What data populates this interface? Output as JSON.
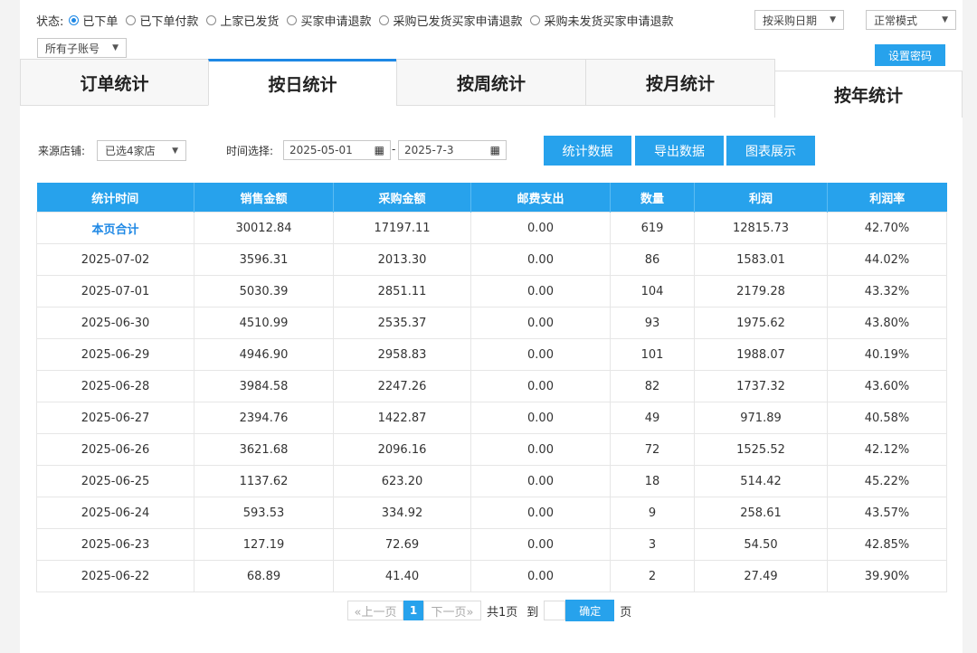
{
  "status": {
    "label": "状态:",
    "options": [
      "已下单",
      "已下单付款",
      "上家已发货",
      "买家申请退款",
      "采购已发货买家申请退款",
      "采购未发货买家申请退款"
    ],
    "selected_index": 0
  },
  "controls": {
    "date_type": "按采购日期",
    "mode": "正常模式",
    "sub_account": "所有子账号",
    "set_password": "设置密码"
  },
  "tabs": [
    "订单统计",
    "按日统计",
    "按周统计",
    "按月统计",
    "按年统计"
  ],
  "filters": {
    "store_label": "来源店铺:",
    "store_value": "已选4家店",
    "time_label": "时间选择:",
    "start_date": "2025-05-01",
    "separator": "-",
    "end_date": "2025-7-3"
  },
  "actions": {
    "stats": "统计数据",
    "export": "导出数据",
    "chart": "图表展示"
  },
  "table": {
    "headers": [
      "统计时间",
      "销售金额",
      "采购金额",
      "邮费支出",
      "数量",
      "利润",
      "利润率"
    ],
    "rows": [
      [
        "本页合计",
        "30012.84",
        "17197.11",
        "0.00",
        "619",
        "12815.73",
        "42.70%"
      ],
      [
        "2025-07-02",
        "3596.31",
        "2013.30",
        "0.00",
        "86",
        "1583.01",
        "44.02%"
      ],
      [
        "2025-07-01",
        "5030.39",
        "2851.11",
        "0.00",
        "104",
        "2179.28",
        "43.32%"
      ],
      [
        "2025-06-30",
        "4510.99",
        "2535.37",
        "0.00",
        "93",
        "1975.62",
        "43.80%"
      ],
      [
        "2025-06-29",
        "4946.90",
        "2958.83",
        "0.00",
        "101",
        "1988.07",
        "40.19%"
      ],
      [
        "2025-06-28",
        "3984.58",
        "2247.26",
        "0.00",
        "82",
        "1737.32",
        "43.60%"
      ],
      [
        "2025-06-27",
        "2394.76",
        "1422.87",
        "0.00",
        "49",
        "971.89",
        "40.58%"
      ],
      [
        "2025-06-26",
        "3621.68",
        "2096.16",
        "0.00",
        "72",
        "1525.52",
        "42.12%"
      ],
      [
        "2025-06-25",
        "1137.62",
        "623.20",
        "0.00",
        "18",
        "514.42",
        "45.22%"
      ],
      [
        "2025-06-24",
        "593.53",
        "334.92",
        "0.00",
        "9",
        "258.61",
        "43.57%"
      ],
      [
        "2025-06-23",
        "127.19",
        "72.69",
        "0.00",
        "3",
        "54.50",
        "42.85%"
      ],
      [
        "2025-06-22",
        "68.89",
        "41.40",
        "0.00",
        "2",
        "27.49",
        "39.90%"
      ]
    ]
  },
  "pager": {
    "prev": "«上一页",
    "current": "1",
    "next": "下一页»",
    "total": "共1页",
    "goto": "到",
    "confirm": "确定",
    "page_suffix": "页"
  },
  "icons": {
    "calendar": "calendar-icon",
    "caret": "chevron-down-icon"
  },
  "colors": {
    "accent": "#27a2ec",
    "link": "#1e88e5"
  }
}
